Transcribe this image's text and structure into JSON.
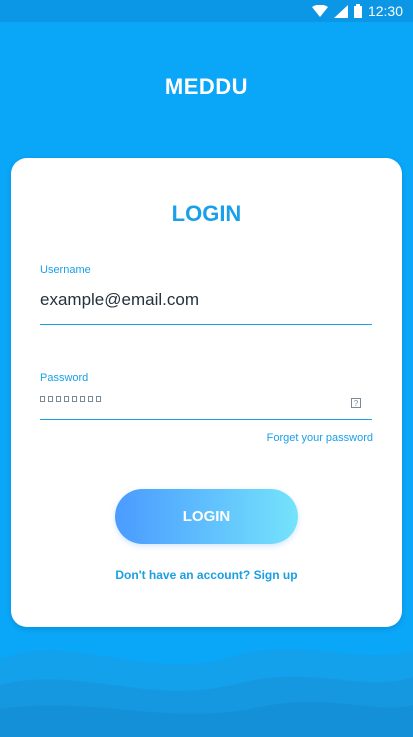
{
  "status_bar": {
    "time": "12:30",
    "icons": [
      "wifi-icon",
      "signal-icon",
      "battery-icon"
    ]
  },
  "app": {
    "title": "MEDDU"
  },
  "login_card": {
    "title": "LOGIN",
    "username": {
      "label": "Username",
      "value": "example@email.com"
    },
    "password": {
      "label": "Password",
      "masked_length": 8,
      "toggle_icon": "visibility-toggle-icon"
    },
    "forget_password": "Forget your password",
    "login_button": "LOGIN",
    "signup_prompt": "Don't have an account? Sign up"
  },
  "colors": {
    "background": "#0aa6f8",
    "accent": "#1aa0e8",
    "button_gradient_start": "#4a9bff",
    "button_gradient_end": "#75e3fb"
  }
}
